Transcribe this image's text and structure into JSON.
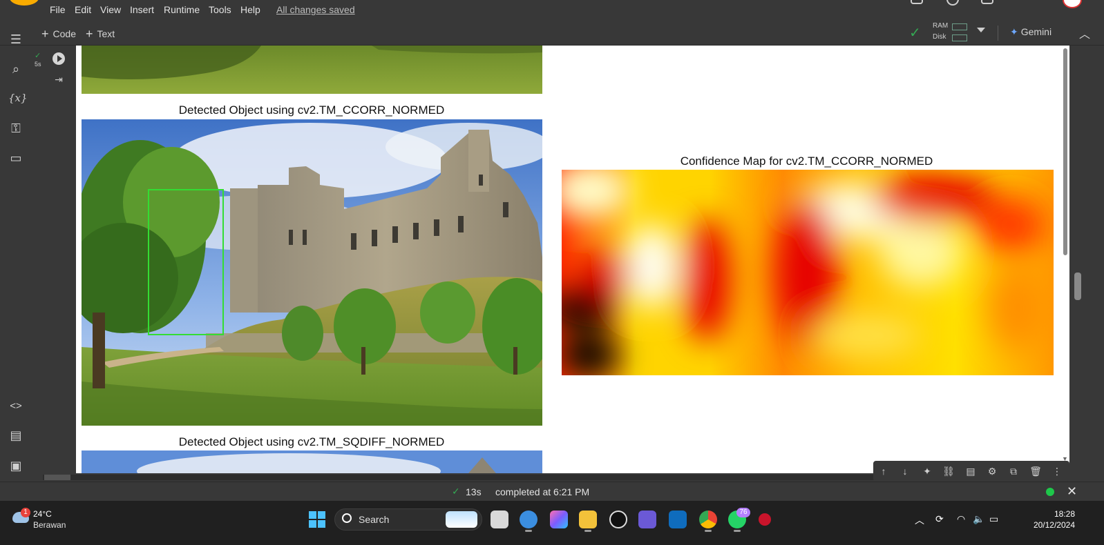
{
  "menu": {
    "items": [
      "File",
      "Edit",
      "View",
      "Insert",
      "Runtime",
      "Tools",
      "Help"
    ],
    "save_status": "All changes saved"
  },
  "toolbar": {
    "add_code": "Code",
    "add_text": "Text",
    "ram_label": "RAM",
    "disk_label": "Disk",
    "gemini_label": "Gemini"
  },
  "cell": {
    "run_duration": "5s"
  },
  "output": {
    "figure_top_title": "Detected Object using cv2.TM_CCORR_NORMED",
    "confidence_title": "Confidence Map for cv2.TM_CCORR_NORMED",
    "figure_bottom_title": "Detected Object using cv2.TM_SQDIFF_NORMED"
  },
  "status": {
    "elapsed": "13s",
    "completed": "completed at 6:21 PM"
  },
  "taskbar": {
    "weather_temp": "24°C",
    "weather_desc": "Berawan",
    "weather_badge": "1",
    "search_label": "Search",
    "whatsapp_badge": "76",
    "time": "18:28",
    "date": "20/12/2024"
  },
  "colors": {
    "accent_green": "#34a853",
    "detection_box": "#33dd33",
    "gemini_star": "#6ea8ff",
    "status_dot": "#1ec74a"
  }
}
